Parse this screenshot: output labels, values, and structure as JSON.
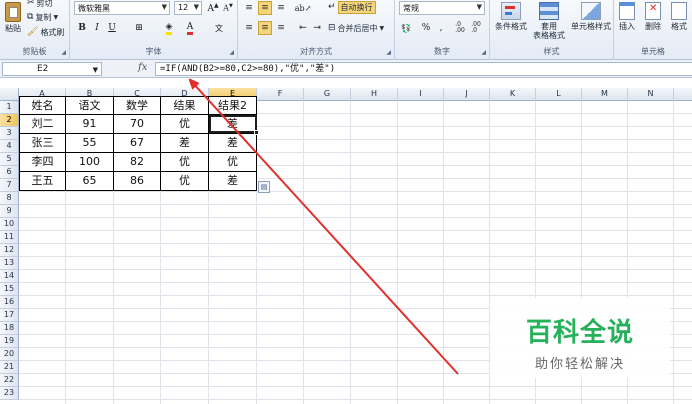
{
  "ribbon": {
    "clipboard": {
      "paste": "粘贴",
      "cut": "剪切",
      "copy": "复制",
      "format_painter": "格式刷",
      "group_label": "剪贴板"
    },
    "font": {
      "font_name": "微软雅黑",
      "font_size": "12",
      "bold": "B",
      "italic": "I",
      "underline": "U",
      "group_label": "字体"
    },
    "alignment": {
      "wrap_text": "自动换行",
      "merge_center": "合并后居中",
      "group_label": "对齐方式"
    },
    "number": {
      "format": "常规",
      "percent": "%",
      "comma": ",",
      "group_label": "数字"
    },
    "styles": {
      "conditional": "条件格式",
      "table_line1": "套用",
      "table_line2": "表格格式",
      "cell_styles": "单元格样式",
      "group_label": "样式"
    },
    "cells": {
      "insert": "插入",
      "delete": "删除",
      "format": "格式",
      "group_label": "单元格"
    }
  },
  "formula_bar": {
    "name_box": "E2",
    "fx": "fx",
    "formula": "=IF(AND(B2>=80,C2>=80),\"优\",\"差\")"
  },
  "columns": [
    "A",
    "B",
    "C",
    "D",
    "E",
    "F",
    "G",
    "H",
    "I",
    "J",
    "K",
    "L",
    "M",
    "N"
  ],
  "rows": [
    "1",
    "2",
    "3",
    "4",
    "5",
    "6",
    "7",
    "8",
    "9",
    "10",
    "11",
    "12",
    "13",
    "14",
    "15",
    "16",
    "17",
    "18",
    "19",
    "20",
    "21",
    "22",
    "23"
  ],
  "table": {
    "headers": [
      "姓名",
      "语文",
      "数学",
      "结果",
      "结果2"
    ],
    "rows": [
      [
        "刘二",
        "91",
        "70",
        "优",
        "差"
      ],
      [
        "张三",
        "55",
        "67",
        "差",
        "差"
      ],
      [
        "李四",
        "100",
        "82",
        "优",
        "优"
      ],
      [
        "王五",
        "65",
        "86",
        "优",
        "差"
      ]
    ]
  },
  "selection": {
    "active_cell": "E2",
    "selected_column": "E",
    "selected_row": "2"
  },
  "watermark": {
    "title": "百科全说",
    "subtitle": "助你轻松解决",
    "color": "#27b05a"
  },
  "annotation_arrow": {
    "color": "#e0302a"
  }
}
